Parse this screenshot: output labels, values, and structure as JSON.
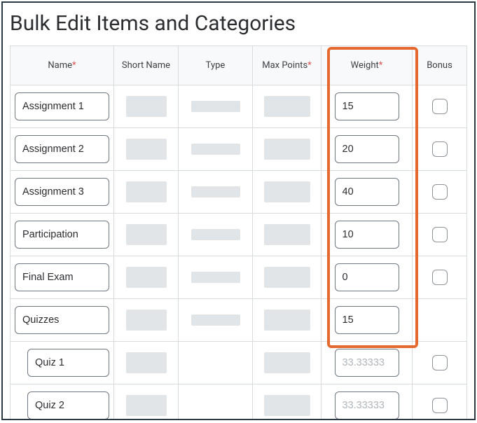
{
  "page_title": "Bulk Edit Items and Categories",
  "columns": {
    "name": {
      "label": "Name",
      "required": true
    },
    "short": {
      "label": "Short Name",
      "required": false
    },
    "type": {
      "label": "Type",
      "required": false
    },
    "points": {
      "label": "Max Points",
      "required": true
    },
    "weight": {
      "label": "Weight",
      "required": true
    },
    "bonus": {
      "label": "Bonus",
      "required": false
    }
  },
  "rows": [
    {
      "name": "Assignment 1",
      "weight": "15",
      "weight_enabled": true,
      "bonus_checkbox": true,
      "indent": false
    },
    {
      "name": "Assignment 2",
      "weight": "20",
      "weight_enabled": true,
      "bonus_checkbox": true,
      "indent": false
    },
    {
      "name": "Assignment 3",
      "weight": "40",
      "weight_enabled": true,
      "bonus_checkbox": true,
      "indent": false
    },
    {
      "name": "Participation",
      "weight": "10",
      "weight_enabled": true,
      "bonus_checkbox": true,
      "indent": false
    },
    {
      "name": "Final Exam",
      "weight": "0",
      "weight_enabled": true,
      "bonus_checkbox": true,
      "indent": false
    },
    {
      "name": "Quizzes",
      "weight": "15",
      "weight_enabled": true,
      "bonus_checkbox": false,
      "indent": false
    },
    {
      "name": "Quiz 1",
      "weight": "33.33333",
      "weight_enabled": false,
      "bonus_checkbox": true,
      "indent": true
    },
    {
      "name": "Quiz 2",
      "weight": "33.33333",
      "weight_enabled": false,
      "bonus_checkbox": true,
      "indent": true
    }
  ],
  "highlight": {
    "column": "weight",
    "color": "#e4692e"
  }
}
